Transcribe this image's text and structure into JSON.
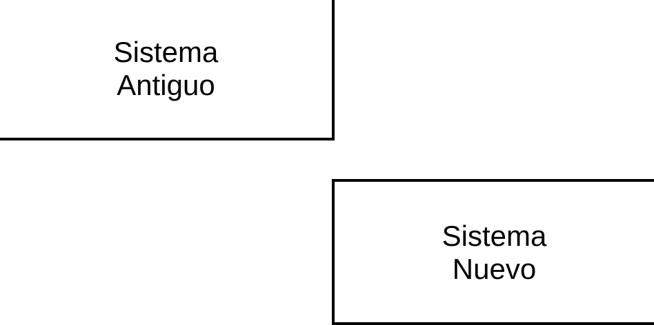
{
  "diagram": {
    "nodes": [
      {
        "line1": "Sistema",
        "line2": "Antiguo"
      },
      {
        "line1": "Sistema",
        "line2": "Nuevo"
      }
    ],
    "colors": {
      "border": "#000000",
      "background": "#ffffff",
      "text": "#000000"
    }
  }
}
